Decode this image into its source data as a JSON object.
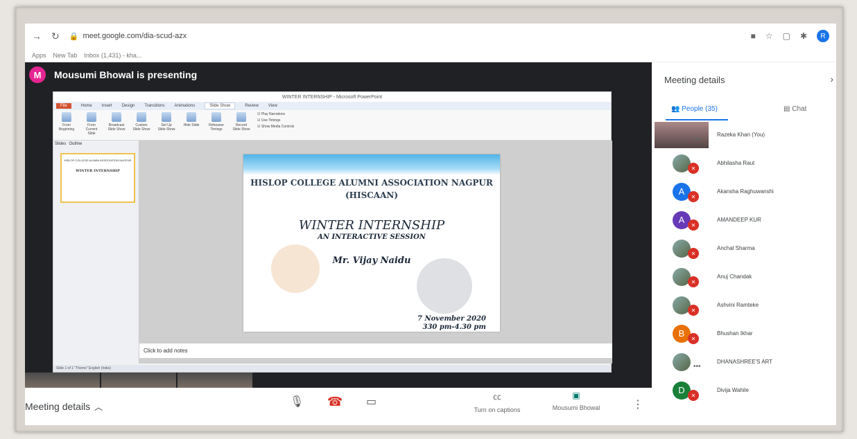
{
  "browser": {
    "url": "meet.google.com/dia-scud-azx",
    "bookmarks": [
      "Apps",
      "New Tab",
      "Inbox (1,431) - kha..."
    ],
    "profile_initial": "R"
  },
  "presenting": {
    "initial": "M",
    "text": "Mousumi Bhowal is presenting",
    "avatar_color": "#e52592"
  },
  "ppt": {
    "window_title": "WINTER INTERNSHIP - Microsoft PowerPoint",
    "tabs": [
      "File",
      "Home",
      "Insert",
      "Design",
      "Transitions",
      "Animations",
      "Slide Show",
      "Review",
      "View"
    ],
    "active_tab": "Slide Show",
    "ribbon_buttons": [
      "From Beginning",
      "From Current Slide",
      "Broadcast Slide Show",
      "Custom Slide Show",
      "Set Up Slide Show",
      "Hide Slide",
      "Rehearse Timings",
      "Record Slide Show"
    ],
    "ribbon_checks": [
      "Play Narrations",
      "Use Timings",
      "Show Media Controls"
    ],
    "thumb_tabs": [
      "Slides",
      "Outline"
    ],
    "slide": {
      "title_line1": "HISLOP COLLEGE ALUMNI ASSOCIATION NAGPUR",
      "title_line2": "(HISCAAN)",
      "main": "WINTER INTERNSHIP",
      "sub": "AN INTERACTIVE SESSION",
      "name": "Mr. Vijay Naidu",
      "date": "7 November 2020",
      "time": "330 pm-4.30 pm"
    },
    "notes_placeholder": "Click to add notes",
    "status": "Slide 1 of 1   \"Theme\"   English (India)"
  },
  "bottom": {
    "meeting_details": "Meeting details",
    "captions": "Turn on captions",
    "presenter": "Mousumi Bhowal"
  },
  "panel": {
    "title": "Meeting details",
    "people_tab": "People (35)",
    "chat_tab": "Chat",
    "accent": "#1a73e8",
    "people": [
      {
        "name": "Razeka Khan (You)",
        "initial": "",
        "color": "",
        "type": "you"
      },
      {
        "name": "Abhilasha Raut",
        "initial": "",
        "color": "",
        "type": "photo"
      },
      {
        "name": "Akansha Raghuwanshi",
        "initial": "A",
        "color": "#1a73e8",
        "type": "letter"
      },
      {
        "name": "AMANDEEP KUR",
        "initial": "A",
        "color": "#673ab7",
        "type": "letter"
      },
      {
        "name": "Anchal Sharma",
        "initial": "",
        "color": "",
        "type": "photo"
      },
      {
        "name": "Anuj Chandak",
        "initial": "",
        "color": "",
        "type": "photo"
      },
      {
        "name": "Ashvini Ramteke",
        "initial": "",
        "color": "",
        "type": "photo"
      },
      {
        "name": "Bhushan Ikhar",
        "initial": "B",
        "color": "#e8710a",
        "type": "letter"
      },
      {
        "name": "DHANASHREE'S ART",
        "initial": "",
        "color": "",
        "type": "photo-dots"
      },
      {
        "name": "Divija Wahile",
        "initial": "D",
        "color": "#188038",
        "type": "letter"
      }
    ]
  }
}
